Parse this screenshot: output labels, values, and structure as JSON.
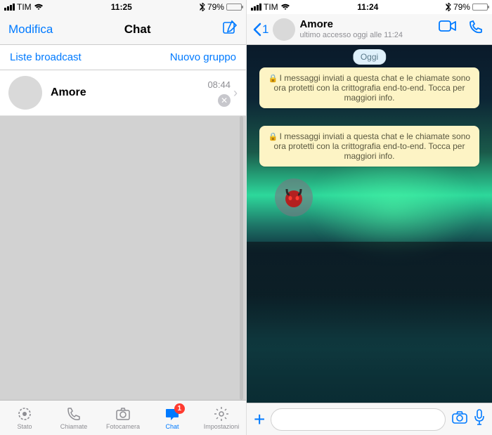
{
  "left": {
    "status": {
      "carrier": "TIM",
      "time": "11:25",
      "battery_pct": "79%"
    },
    "header": {
      "edit": "Modifica",
      "title": "Chat"
    },
    "subheader": {
      "broadcast": "Liste broadcast",
      "newgroup": "Nuovo gruppo"
    },
    "chats": [
      {
        "name": "Amore",
        "time": "08:44"
      }
    ],
    "tabs": {
      "status": "Stato",
      "calls": "Chiamate",
      "camera": "Fotocamera",
      "chat": "Chat",
      "settings": "Impostazioni",
      "badge": "1"
    }
  },
  "right": {
    "status": {
      "carrier": "TIM",
      "time": "11:24",
      "battery_pct": "79%"
    },
    "header": {
      "back_count": "1",
      "name": "Amore",
      "subtitle": "ultimo accesso oggi alle 11:24"
    },
    "date_pill": "Oggi",
    "system_message": "I messaggi inviati a questa chat e le chiamate sono ora protetti con la crittografia end-to-end. Tocca per maggiori info."
  }
}
